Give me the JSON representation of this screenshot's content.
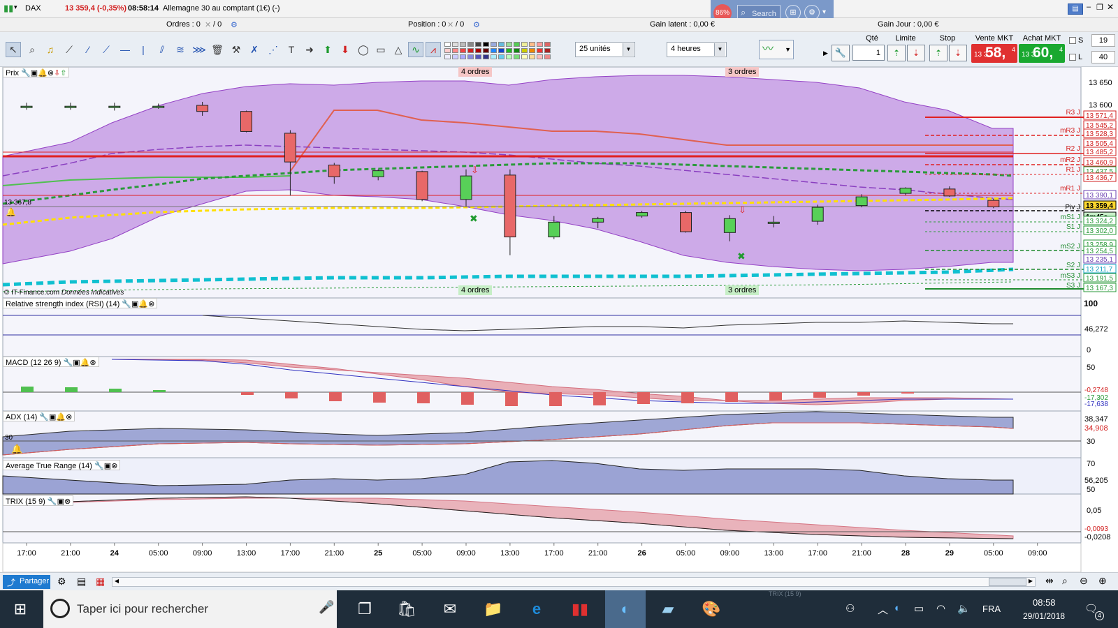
{
  "titlebar": {
    "symbol": "DAX",
    "price_change": "13 359,4 (-0,35%)",
    "time": "08:58:14",
    "instrument": "Allemagne 30 au comptant (1€) (-)",
    "zoom_badge": "86%",
    "search_placeholder": "Search"
  },
  "infobar": {
    "orders_label": "Ordres : 0",
    "orders_slash": "/ 0",
    "position_label": "Position : 0",
    "position_slash": "/ 0",
    "gain_latent": "Gain latent : 0,00 €",
    "gain_jour": "Gain Jour : 0,00 €"
  },
  "toolbar": {
    "units_combo": "25 unités",
    "period_combo": "4 heures"
  },
  "order_panel": {
    "qty_label": "Qté",
    "qty_value": "1",
    "limit_label": "Limite",
    "stop_label": "Stop",
    "sell_label": "Vente MKT",
    "buy_label": "Achat MKT",
    "sell_small": "13 3",
    "sell_big": "58,",
    "sell_sup": "4",
    "buy_small": "13 3",
    "buy_big": "60,",
    "buy_sup": "4",
    "s_label": "S",
    "s_value": "19",
    "l_label": "L",
    "l_value": "40"
  },
  "panels": {
    "price": "Prix",
    "rsi": "Relative strength index (RSI) (14)",
    "macd": "MACD (12 26 9)",
    "adx": "ADX (14)",
    "atr": "Average True Range (14)",
    "trix": "TRIX (15 9)"
  },
  "price_chart": {
    "copyright": "© IT-Finance.com",
    "data_note": "Données indicatives",
    "left_price_label": "13 367,8",
    "top_order_tags": [
      "4 ordres",
      "3 ordres"
    ],
    "bottom_order_tags": [
      "4 ordres",
      "3 ordres"
    ],
    "y_ticks": [
      "13 650",
      "13 600"
    ],
    "pivot_labels": [
      "R3 J",
      "mR3 J",
      "R2 J",
      "mR2 J",
      "R1 J",
      "mR1 J",
      "Piv J",
      "mS1 J",
      "S1 J",
      "mS2 J",
      "S2 J",
      "mS3 J",
      "S3 J"
    ],
    "right_labels": [
      {
        "text": "13 571,4",
        "color": "#d22020"
      },
      {
        "text": "13 545,2",
        "color": "#d22020"
      },
      {
        "text": "13 528,3",
        "color": "#d22020"
      },
      {
        "text": "13 505,4",
        "color": "#d22020"
      },
      {
        "text": "13 485,2",
        "color": "#d22020"
      },
      {
        "text": "13 460,9",
        "color": "#d22020"
      },
      {
        "text": "13 437,5",
        "color": "#2a9a3a"
      },
      {
        "text": "13 436,7",
        "color": "#d22020"
      },
      {
        "text": "13 390,1",
        "color": "#6a3fb0"
      },
      {
        "text": "13 359,4",
        "color": "#000000"
      },
      {
        "text": "1m45s",
        "color": "#000000"
      },
      {
        "text": "13 324,2",
        "color": "#2a9a3a"
      },
      {
        "text": "13 302,0",
        "color": "#2a9a3a"
      },
      {
        "text": "13 258,9",
        "color": "#2a9a3a"
      },
      {
        "text": "13 254,5",
        "color": "#2a9a3a"
      },
      {
        "text": "13 235,1",
        "color": "#6a3fb0"
      },
      {
        "text": "13 211,7",
        "color": "#10a0c0"
      },
      {
        "text": "13 191,5",
        "color": "#2a9a3a"
      },
      {
        "text": "13 167,3",
        "color": "#2a9a3a"
      }
    ]
  },
  "rsi": {
    "top": "100",
    "bottom": "0",
    "value": "46,272"
  },
  "macd": {
    "top": "50",
    "value1": "-0,2748",
    "value2": "-17,302",
    "value3": "-17,638"
  },
  "adx": {
    "value1": "38,347",
    "value2": "34,908",
    "tick": "30",
    "left_level": "30"
  },
  "atr": {
    "tick1": "70",
    "value": "56,205",
    "tick2": "50"
  },
  "trix": {
    "tick": "0,05",
    "value1": "-0,0093",
    "value2": "-0,0208"
  },
  "time_axis": [
    "17:00",
    "21:00",
    "24",
    "05:00",
    "09:00",
    "13:00",
    "17:00",
    "21:00",
    "25",
    "05:00",
    "09:00",
    "13:00",
    "17:00",
    "21:00",
    "26",
    "05:00",
    "09:00",
    "13:00",
    "17:00",
    "21:00",
    "28",
    "29",
    "05:00",
    "09:00"
  ],
  "bottombar": {
    "share": "Partager"
  },
  "taskbar": {
    "search_placeholder": "Taper ici pour rechercher",
    "lang": "FRA",
    "time": "08:58",
    "date": "29/01/2018",
    "notif_count": "4",
    "ghost_label": "TRIX (15 9)"
  },
  "chart_data": {
    "type": "candlestick",
    "title": "DAX",
    "candles": [
      {
        "t": "17:00",
        "o": 13590,
        "h": 13598,
        "l": 13582,
        "c": 13590
      },
      {
        "t": "21:00",
        "o": 13590,
        "h": 13598,
        "l": 13582,
        "c": 13590
      },
      {
        "t": "24",
        "o": 13590,
        "h": 13598,
        "l": 13580,
        "c": 13590
      },
      {
        "t": "05:00",
        "o": 13590,
        "h": 13596,
        "l": 13584,
        "c": 13590
      },
      {
        "t": "09:00",
        "o": 13592,
        "h": 13600,
        "l": 13568,
        "c": 13578
      },
      {
        "t": "13:00",
        "o": 13578,
        "h": 13580,
        "l": 13530,
        "c": 13532
      },
      {
        "t": "17:00",
        "o": 13528,
        "h": 13535,
        "l": 13385,
        "c": 13462
      },
      {
        "t": "21:00",
        "o": 13455,
        "h": 13460,
        "l": 13412,
        "c": 13428
      },
      {
        "t": "25",
        "o": 13428,
        "h": 13445,
        "l": 13420,
        "c": 13442
      },
      {
        "t": "05:00",
        "o": 13440,
        "h": 13442,
        "l": 13372,
        "c": 13376
      },
      {
        "t": "09:00",
        "o": 13376,
        "h": 13445,
        "l": 13360,
        "c": 13430
      },
      {
        "t": "13:00",
        "o": 13432,
        "h": 13445,
        "l": 13248,
        "c": 13290
      },
      {
        "t": "17:00",
        "o": 13290,
        "h": 13338,
        "l": 13285,
        "c": 13324
      },
      {
        "t": "21:00",
        "o": 13324,
        "h": 13336,
        "l": 13310,
        "c": 13332
      },
      {
        "t": "26",
        "o": 13338,
        "h": 13350,
        "l": 13334,
        "c": 13346
      },
      {
        "t": "05:00",
        "o": 13346,
        "h": 13350,
        "l": 13300,
        "c": 13302
      },
      {
        "t": "09:00",
        "o": 13300,
        "h": 13340,
        "l": 13280,
        "c": 13332
      },
      {
        "t": "13:00",
        "o": 13322,
        "h": 13338,
        "l": 13312,
        "c": 13324
      },
      {
        "t": "17:00",
        "o": 13326,
        "h": 13364,
        "l": 13318,
        "c": 13358
      },
      {
        "t": "21:00",
        "o": 13362,
        "h": 13388,
        "l": 13358,
        "c": 13382
      },
      {
        "t": "28",
        "o": 13390,
        "h": 13404,
        "l": 13386,
        "c": 13402
      },
      {
        "t": "29",
        "o": 13400,
        "h": 13406,
        "l": 13382,
        "c": 13384
      },
      {
        "t": "05:00",
        "o": 13374,
        "h": 13378,
        "l": 13356,
        "c": 13359
      }
    ],
    "ylim": [
      13150,
      13680
    ]
  }
}
